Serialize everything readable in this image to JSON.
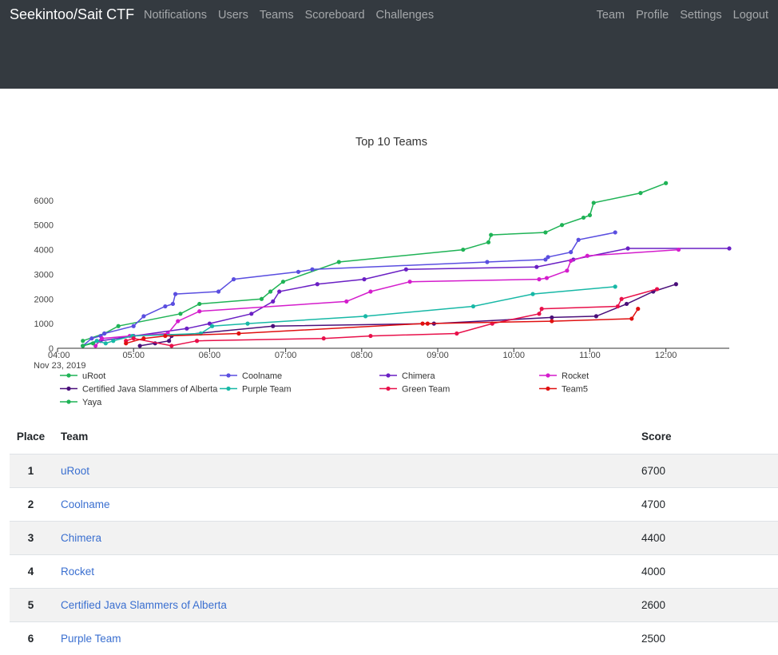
{
  "nav": {
    "brand": "Seekintoo/Sait CTF",
    "left": [
      "Notifications",
      "Users",
      "Teams",
      "Scoreboard",
      "Challenges"
    ],
    "right": [
      "Team",
      "Profile",
      "Settings",
      "Logout"
    ]
  },
  "chart_data": {
    "type": "line",
    "title": "Top 10 Teams",
    "ylim": [
      0,
      7000
    ],
    "y_ticks": [
      0,
      1000,
      2000,
      3000,
      4000,
      5000,
      6000
    ],
    "x_ticks": [
      "04:00",
      "05:00",
      "06:00",
      "07:00",
      "08:00",
      "09:00",
      "10:00",
      "11:00",
      "12:00"
    ],
    "x_date": "Nov 23, 2019",
    "x_range": [
      "04:00",
      "12:50"
    ],
    "legend_position": "bottom",
    "series": [
      {
        "name": "uRoot",
        "color": "#1fb356",
        "points": [
          [
            "04:20",
            300
          ],
          [
            "04:37",
            600
          ],
          [
            "04:48",
            900
          ],
          [
            "05:37",
            1400
          ],
          [
            "05:52",
            1800
          ],
          [
            "06:41",
            2000
          ],
          [
            "06:48",
            2300
          ],
          [
            "06:58",
            2700
          ],
          [
            "07:42",
            3500
          ],
          [
            "09:20",
            4000
          ],
          [
            "09:40",
            4300
          ],
          [
            "09:42",
            4600
          ],
          [
            "10:25",
            4700
          ],
          [
            "10:38",
            5000
          ],
          [
            "10:55",
            5300
          ],
          [
            "11:00",
            5400
          ],
          [
            "11:03",
            5900
          ],
          [
            "11:40",
            6300
          ],
          [
            "12:00",
            6700
          ]
        ]
      },
      {
        "name": "Coolname",
        "color": "#5a4ee0",
        "points": [
          [
            "04:20",
            100
          ],
          [
            "04:27",
            400
          ],
          [
            "04:34",
            500
          ],
          [
            "04:37",
            600
          ],
          [
            "05:00",
            900
          ],
          [
            "05:08",
            1300
          ],
          [
            "05:25",
            1700
          ],
          [
            "05:31",
            1800
          ],
          [
            "05:33",
            2200
          ],
          [
            "06:07",
            2300
          ],
          [
            "06:19",
            2800
          ],
          [
            "07:10",
            3100
          ],
          [
            "07:21",
            3200
          ],
          [
            "09:39",
            3500
          ],
          [
            "10:25",
            3600
          ],
          [
            "10:27",
            3700
          ],
          [
            "10:45",
            3900
          ],
          [
            "10:51",
            4400
          ],
          [
            "11:20",
            4700
          ]
        ]
      },
      {
        "name": "Chimera",
        "color": "#6a1fc4",
        "points": [
          [
            "04:20",
            100
          ],
          [
            "04:34",
            300
          ],
          [
            "05:00",
            500
          ],
          [
            "05:42",
            800
          ],
          [
            "06:00",
            1000
          ],
          [
            "06:33",
            1400
          ],
          [
            "06:50",
            1900
          ],
          [
            "06:55",
            2300
          ],
          [
            "07:25",
            2600
          ],
          [
            "08:02",
            2800
          ],
          [
            "08:35",
            3200
          ],
          [
            "10:18",
            3300
          ],
          [
            "10:47",
            3600
          ],
          [
            "11:30",
            4050
          ],
          [
            "12:50",
            4050
          ]
        ]
      },
      {
        "name": "Rocket",
        "color": "#d41ccc",
        "points": [
          [
            "04:30",
            100
          ],
          [
            "04:35",
            400
          ],
          [
            "04:57",
            500
          ],
          [
            "05:27",
            600
          ],
          [
            "05:35",
            1100
          ],
          [
            "05:52",
            1500
          ],
          [
            "07:48",
            1900
          ],
          [
            "08:07",
            2300
          ],
          [
            "08:38",
            2700
          ],
          [
            "10:20",
            2800
          ],
          [
            "10:26",
            2850
          ],
          [
            "10:42",
            3150
          ],
          [
            "10:45",
            3550
          ],
          [
            "10:58",
            3750
          ],
          [
            "12:10",
            4000
          ]
        ]
      },
      {
        "name": "Certified Java Slammers of Alberta",
        "color": "#4a0f7a",
        "points": [
          [
            "05:05",
            100
          ],
          [
            "05:17",
            200
          ],
          [
            "05:28",
            300
          ],
          [
            "05:30",
            500
          ],
          [
            "06:50",
            900
          ],
          [
            "08:57",
            1000
          ],
          [
            "10:30",
            1250
          ],
          [
            "11:05",
            1300
          ],
          [
            "11:29",
            1800
          ],
          [
            "11:50",
            2300
          ],
          [
            "12:08",
            2600
          ]
        ]
      },
      {
        "name": "Purple Team",
        "color": "#17b8a6",
        "points": [
          [
            "04:20",
            100
          ],
          [
            "04:31",
            300
          ],
          [
            "04:38",
            200
          ],
          [
            "04:44",
            300
          ],
          [
            "04:59",
            500
          ],
          [
            "05:53",
            600
          ],
          [
            "06:02",
            900
          ],
          [
            "06:30",
            1000
          ],
          [
            "08:03",
            1300
          ],
          [
            "09:28",
            1700
          ],
          [
            "10:15",
            2200
          ],
          [
            "11:20",
            2500
          ]
        ]
      },
      {
        "name": "Green Team",
        "color": "#e8104a",
        "points": [
          [
            "04:54",
            300
          ],
          [
            "05:00",
            400
          ],
          [
            "05:30",
            100
          ],
          [
            "05:50",
            300
          ],
          [
            "07:30",
            400
          ],
          [
            "08:07",
            500
          ],
          [
            "09:15",
            600
          ],
          [
            "09:43",
            1000
          ],
          [
            "10:20",
            1400
          ],
          [
            "10:22",
            1600
          ],
          [
            "11:22",
            1700
          ],
          [
            "11:25",
            2000
          ],
          [
            "11:53",
            2400
          ]
        ]
      },
      {
        "name": "Team5",
        "color": "#e01010",
        "points": [
          [
            "04:54",
            200
          ],
          [
            "05:08",
            400
          ],
          [
            "05:25",
            500
          ],
          [
            "06:23",
            600
          ],
          [
            "08:48",
            1000
          ],
          [
            "08:52",
            1000
          ],
          [
            "10:30",
            1100
          ],
          [
            "11:33",
            1200
          ],
          [
            "11:38",
            1600
          ]
        ]
      },
      {
        "name": "Yaya",
        "color": "#1fb356",
        "points": [
          [
            "04:20",
            100
          ],
          [
            "04:28",
            200
          ]
        ]
      }
    ]
  },
  "table": {
    "headers": {
      "place": "Place",
      "team": "Team",
      "score": "Score"
    },
    "rows": [
      {
        "place": "1",
        "team": "uRoot",
        "score": "6700"
      },
      {
        "place": "2",
        "team": "Coolname",
        "score": "4700"
      },
      {
        "place": "3",
        "team": "Chimera",
        "score": "4400"
      },
      {
        "place": "4",
        "team": "Rocket",
        "score": "4000"
      },
      {
        "place": "5",
        "team": "Certified Java Slammers of Alberta",
        "score": "2600"
      },
      {
        "place": "6",
        "team": "Purple Team",
        "score": "2500"
      }
    ]
  }
}
